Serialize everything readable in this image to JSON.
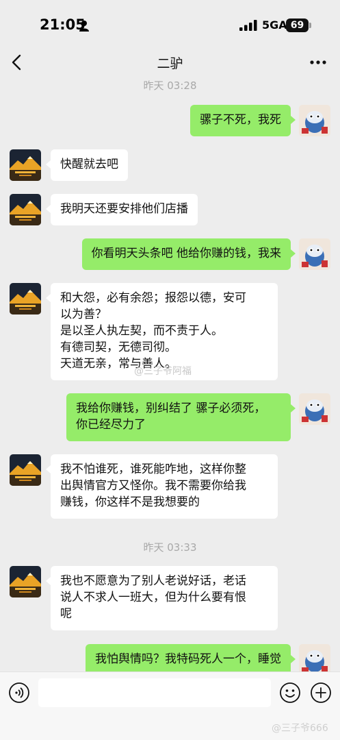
{
  "status_bar": {
    "time": "21:05",
    "network": "5GA",
    "battery": "69"
  },
  "header": {
    "title": "二驴"
  },
  "messages": [
    {
      "type": "time",
      "text": "昨天 03:28"
    },
    {
      "type": "out",
      "text": "骡子不死，我死"
    },
    {
      "type": "in",
      "text": "快醒就去吧"
    },
    {
      "type": "in",
      "text": "我明天还要安排他们店播"
    },
    {
      "type": "out",
      "text": "你看明天头条吧 他给你赚的钱，我来"
    },
    {
      "type": "in",
      "text": "和大怨，必有余怨；报怨以德，安可\n以为善？\n是以圣人执左契，而不责于人。\n有德司契，无德司彻。\n天道无亲，常与善人。"
    },
    {
      "type": "out",
      "text": "我给你赚钱，别纠结了 骡子必须死，\n你已经尽力了"
    },
    {
      "type": "in",
      "text": "我不怕谁死，谁死能咋地，这样你整\n出舆情官方又怪你。我不需要你给我\n赚钱，你这样不是我想要的"
    },
    {
      "type": "time",
      "text": "昨天 03:33"
    },
    {
      "type": "in",
      "text": "我也不愿意为了别人老说好话，老话\n说人不求人一班大，但为什么要有恨\n呢"
    },
    {
      "type": "out",
      "text": "我怕舆情吗？我特码死人一个，睡觉"
    }
  ],
  "watermarks": {
    "middle": "@三子爷阿福",
    "bottom": "@三子爷666"
  },
  "icons": {
    "back": "chevron-left-icon",
    "more": "more-dots-icon",
    "voice": "voice-icon",
    "emoji": "emoji-icon",
    "plus": "plus-icon"
  },
  "colors": {
    "background": "#ededed",
    "outgoing_bubble": "#95ec69",
    "incoming_bubble": "#ffffff"
  }
}
